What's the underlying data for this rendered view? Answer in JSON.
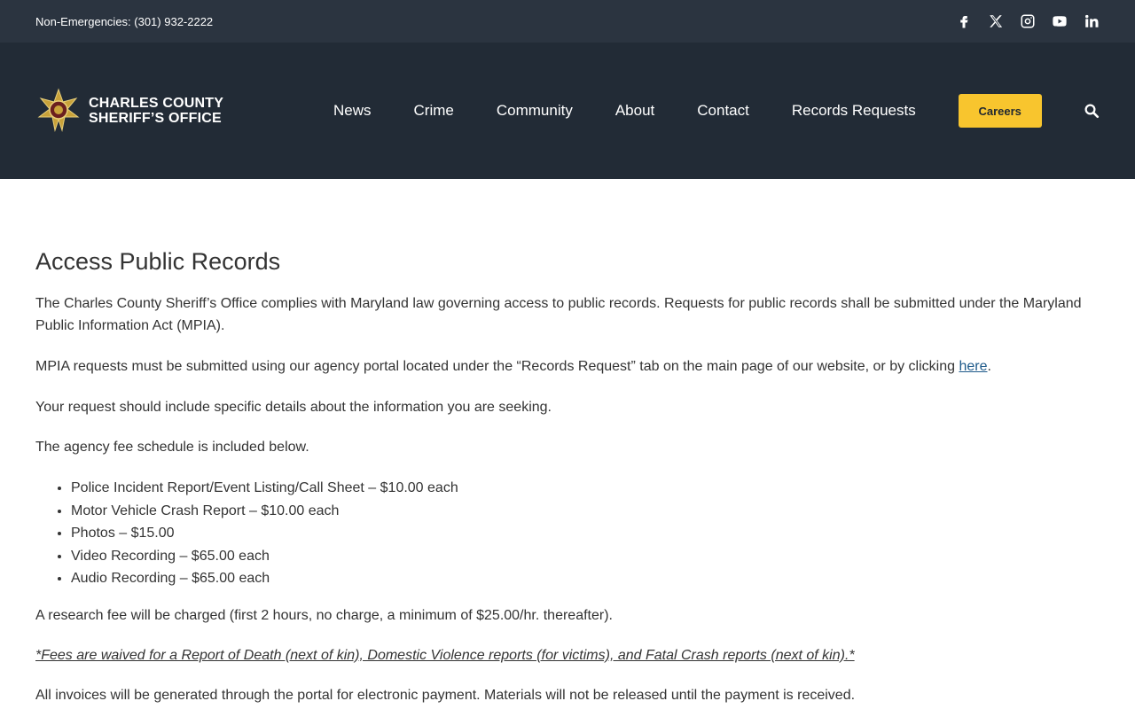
{
  "topbar": {
    "phone": "Non-Emergencies: (301) 932-2222",
    "social": [
      "facebook-icon",
      "x-icon",
      "instagram-icon",
      "youtube-icon",
      "linkedin-icon"
    ],
    "background": "#2b3440"
  },
  "header": {
    "logo": {
      "line1": "CHARLES COUNTY",
      "line2": "SHERIFF’S OFFICE"
    },
    "nav": [
      "News",
      "Crime",
      "Community",
      "About",
      "Contact",
      "Records Requests"
    ],
    "careers_label": "Careers",
    "accent": "#f8c52e",
    "background": "#222b36"
  },
  "main": {
    "title": "Access Public Records",
    "p1": "The Charles County Sheriff’s Office complies with Maryland law governing access to public records. Requests for public records shall be submitted under the Maryland Public Information Act (MPIA).",
    "p2_text": "MPIA requests must be submitted using our agency portal located under the “Records Request” tab on the main page of our website, or by clicking ",
    "p2_link": "here",
    "p2_end": ".",
    "p3": "Your request should include specific details about the information you are seeking.",
    "p4": "The agency fee schedule is included below.",
    "fees": [
      "Police Incident Report/Event Listing/Call Sheet – $10.00 each",
      "Motor Vehicle Crash Report – $10.00 each",
      "Photos – $15.00",
      "Video Recording – $65.00 each",
      "Audio Recording – $65.00 each"
    ],
    "p5": "A research fee will be charged (first 2 hours, no charge, a minimum of $25.00/hr. thereafter).",
    "p6": "*Fees are waived for a Report of Death (next of kin), Domestic Violence reports (for victims), and Fatal Crash reports (next of kin).*",
    "p7": "All invoices will be generated through the portal for electronic payment. Materials will not be released until the payment is received."
  }
}
